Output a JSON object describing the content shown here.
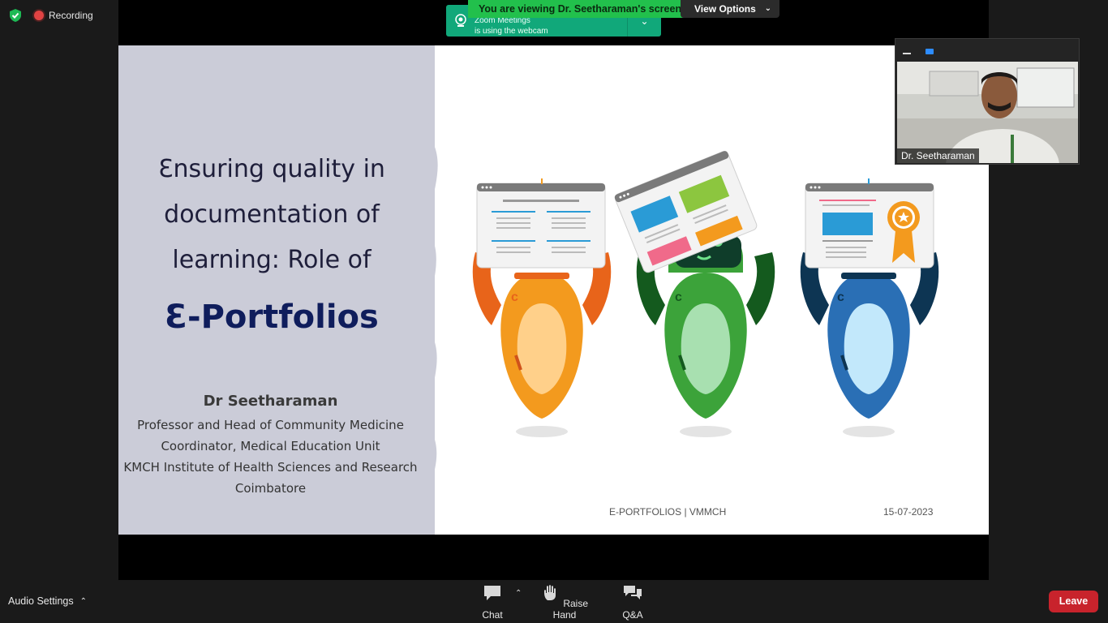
{
  "status": {
    "recording_label": "Recording"
  },
  "notification": {
    "viewing_text": "You are viewing Dr. Seetharaman's screen",
    "view_options_label": "View Options",
    "webcam_msg_line1": "Zoom Meetings",
    "webcam_msg_line2": "is using the webcam"
  },
  "slide": {
    "title_line1": "Ɛnsuring quality in",
    "title_line2": "documentation of",
    "title_line3": "learning: Role of",
    "title_emph": "Ɛ-Portfolios",
    "author_name": "Dr Seetharaman",
    "author_line1": "Professor and Head of  Community Medicine",
    "author_line2": "Coordinator, Medical Education Unit",
    "author_line3": "KMCH Institute of Health Sciences and Research",
    "author_line4": "Coimbatore",
    "footer_left": "E-PORTFOLIOS | VMMCH",
    "footer_right": "15-07-2023"
  },
  "video": {
    "participant_name": "Dr. Seetharaman"
  },
  "toolbar": {
    "audio_settings_label": "Audio Settings",
    "chat_label": "Chat",
    "raise_hand_label": "Raise Hand",
    "qa_label": "Q&A",
    "leave_label": "Leave"
  },
  "colors": {
    "leave_red": "#c8232c",
    "viewing_green": "#22c04c",
    "notice_teal": "#11a87a",
    "robot_orange": "#f39a1e",
    "robot_green": "#3ca33a",
    "robot_blue": "#2a6fb5"
  }
}
